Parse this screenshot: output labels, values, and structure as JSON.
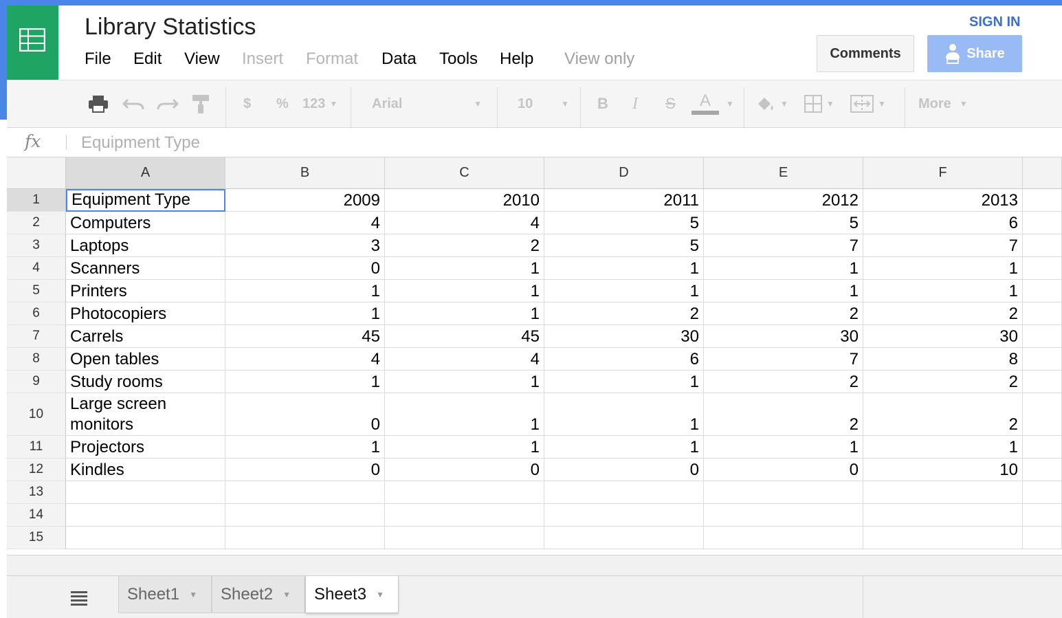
{
  "app": {
    "title": "Library Statistics",
    "sign_in": "SIGN IN",
    "comments_label": "Comments",
    "share_label": "Share",
    "menu": [
      {
        "label": "File",
        "enabled": true
      },
      {
        "label": "Edit",
        "enabled": true
      },
      {
        "label": "View",
        "enabled": true
      },
      {
        "label": "Insert",
        "enabled": false
      },
      {
        "label": "Format",
        "enabled": false
      },
      {
        "label": "Data",
        "enabled": true
      },
      {
        "label": "Tools",
        "enabled": true
      },
      {
        "label": "Help",
        "enabled": true
      }
    ],
    "mode_label": "View only",
    "brand_color": "#1fa463",
    "accent_color": "#4a86e8"
  },
  "toolbar": {
    "currency": "$",
    "percent": "%",
    "number_format": "123",
    "font": "Arial",
    "font_size": "10",
    "bold": "B",
    "italic": "I",
    "strike": "S",
    "text_color": "A",
    "more": "More"
  },
  "formula_bar": {
    "fx": "fx",
    "content": "Equipment Type"
  },
  "columns": [
    "A",
    "B",
    "C",
    "D",
    "E",
    "F"
  ],
  "rows": [
    {
      "num": "1",
      "cells": [
        "Equipment Type",
        "2009",
        "2010",
        "2011",
        "2012",
        "2013"
      ]
    },
    {
      "num": "2",
      "cells": [
        "Computers",
        "4",
        "4",
        "5",
        "5",
        "6"
      ]
    },
    {
      "num": "3",
      "cells": [
        "Laptops",
        "3",
        "2",
        "5",
        "7",
        "7"
      ]
    },
    {
      "num": "4",
      "cells": [
        "Scanners",
        "0",
        "1",
        "1",
        "1",
        "1"
      ]
    },
    {
      "num": "5",
      "cells": [
        "Printers",
        "1",
        "1",
        "1",
        "1",
        "1"
      ]
    },
    {
      "num": "6",
      "cells": [
        "Photocopiers",
        "1",
        "1",
        "2",
        "2",
        "2"
      ]
    },
    {
      "num": "7",
      "cells": [
        "Carrels",
        "45",
        "45",
        "30",
        "30",
        "30"
      ]
    },
    {
      "num": "8",
      "cells": [
        "Open tables",
        "4",
        "4",
        "6",
        "7",
        "8"
      ]
    },
    {
      "num": "9",
      "cells": [
        "Study rooms",
        "1",
        "1",
        "1",
        "2",
        "2"
      ]
    },
    {
      "num": "10",
      "cells": [
        "Large screen monitors",
        "0",
        "1",
        "1",
        "2",
        "2"
      ]
    },
    {
      "num": "11",
      "cells": [
        "Projectors",
        "1",
        "1",
        "1",
        "1",
        "1"
      ]
    },
    {
      "num": "12",
      "cells": [
        "Kindles",
        "0",
        "0",
        "0",
        "0",
        "10"
      ]
    },
    {
      "num": "13",
      "cells": [
        "",
        "",
        "",
        "",
        "",
        ""
      ]
    },
    {
      "num": "14",
      "cells": [
        "",
        "",
        "",
        "",
        "",
        ""
      ]
    },
    {
      "num": "15",
      "cells": [
        "",
        "",
        "",
        "",
        "",
        ""
      ]
    }
  ],
  "active_cell": "A1",
  "sheets": [
    {
      "label": "Sheet1",
      "active": false
    },
    {
      "label": "Sheet2",
      "active": false
    },
    {
      "label": "Sheet3",
      "active": true
    }
  ]
}
